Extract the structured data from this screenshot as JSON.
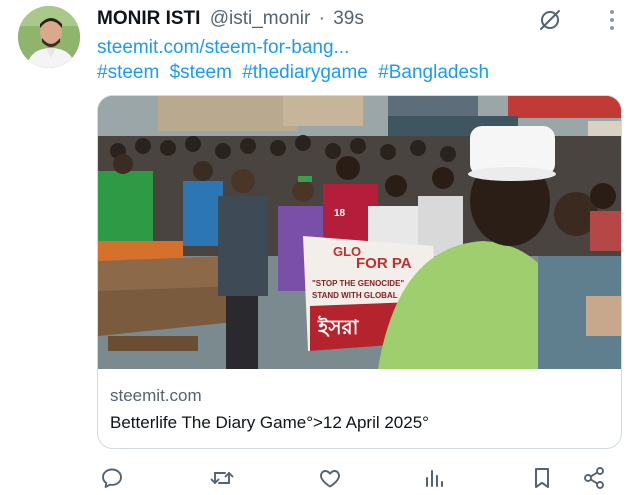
{
  "tweet": {
    "author_name": "MONIR ISTI",
    "handle": "@isti_monir",
    "separator": "·",
    "time": "39s",
    "link": "steemit.com/steem-for-bang...",
    "hashtags": [
      "#steem",
      "$steem",
      "#thediarygame",
      "#Bangladesh"
    ]
  },
  "card": {
    "domain": "steemit.com",
    "title": "Betterlife The Diary Game°>12 April 2025°",
    "banner_lines": [
      "GLO",
      "FOR PA",
      "\"STOP THE GENOCIDE\"",
      "STAND WITH GLOBAL",
      "ইসরা"
    ],
    "shirt_number": "18"
  },
  "icons": {
    "top": [
      "grok-slash-icon",
      "more-vertical-icon"
    ],
    "actions": [
      "reply-icon",
      "retweet-icon",
      "like-icon",
      "views-icon",
      "bookmark-icon",
      "share-icon"
    ]
  },
  "colors": {
    "link": "#1d9bf0",
    "secondary_text": "#536471",
    "border": "#cfd9de",
    "icon": "#536471"
  }
}
